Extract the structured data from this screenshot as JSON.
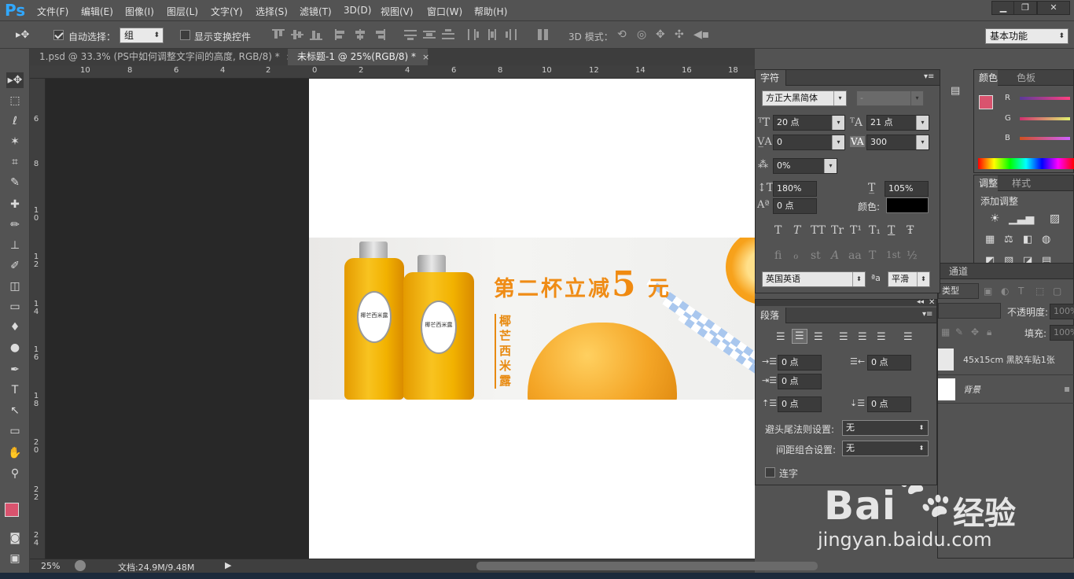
{
  "app": {
    "logo": "Ps"
  },
  "menu": [
    "文件(F)",
    "编辑(E)",
    "图像(I)",
    "图层(L)",
    "文字(Y)",
    "选择(S)",
    "滤镜(T)",
    "3D(D)",
    "视图(V)",
    "窗口(W)",
    "帮助(H)"
  ],
  "window_controls": {
    "minimize": "▁",
    "restore": "❐",
    "close": "✕"
  },
  "options": {
    "auto_select_label": "自动选择：",
    "auto_select_value": "组",
    "show_transform_label": "显示变换控件",
    "mode3d_label": "3D 模式：",
    "workspace": "基本功能"
  },
  "tabs": [
    {
      "label": "1.psd @ 33.3% (PS中如何调整文字间的高度, RGB/8) *",
      "close": "×"
    },
    {
      "label": "未标题-1 @ 25%(RGB/8) *",
      "close": "×"
    }
  ],
  "ruler_top": [
    "10",
    "8",
    "6",
    "4",
    "2",
    "0",
    "2",
    "4",
    "6",
    "8",
    "10",
    "12",
    "14",
    "16",
    "18"
  ],
  "ruler_left": [
    "6",
    "8",
    "1\n0",
    "1\n2",
    "1\n4",
    "1\n6",
    "1\n8",
    "2\n0",
    "2\n2",
    "2\n4"
  ],
  "banner": {
    "headline_pre": "第二杯立减",
    "headline_num": "5",
    "headline_post": "元",
    "vertical": "椰芒西米露",
    "bottle_label": "椰芒西米露"
  },
  "status": {
    "zoom": "25%",
    "doc": "文档:24.9M/9.48M"
  },
  "char_panel": {
    "title": "字符",
    "font": "方正大黑简体",
    "style": "-",
    "size": "20 点",
    "leading": "21 点",
    "kerning": "0",
    "tracking": "300",
    "tsume": "0%",
    "vscale": "180%",
    "hscale": "105%",
    "baseline": "0 点",
    "color_label": "颜色:",
    "language": "英国英语",
    "aa_icon": "ªa",
    "antialias": "平滑",
    "style_glyphs": [
      "T",
      "T",
      "TT",
      "Tr",
      "T¹",
      "T₁",
      "T",
      "Ŧ"
    ],
    "ot_glyphs": [
      "fi",
      "ℴ",
      "st",
      "A",
      "aa",
      "T",
      "1st",
      "½"
    ]
  },
  "para_panel": {
    "title": "段落",
    "indent_left": "0 点",
    "indent_right": "0 点",
    "indent_first": "0 点",
    "space_before": "0 点",
    "space_after": "0 点",
    "kinsoku_label": "避头尾法则设置:",
    "kinsoku_value": "无",
    "mojikumi_label": "间距组合设置:",
    "mojikumi_value": "无",
    "hyphenate_label": "连字"
  },
  "color_panel": {
    "tab1": "颜色",
    "tab2": "色板",
    "r": "R",
    "g": "G",
    "b": "B",
    "fg": "#d9536e"
  },
  "adjust_panel": {
    "tab1": "调整",
    "tab2": "样式",
    "add_label": "添加调整"
  },
  "layers_panel": {
    "channels_tab": "通道",
    "kind_label": "类型",
    "opacity_label": "不透明度:",
    "opacity_value": "100%",
    "fill_label": "填充:",
    "fill_value": "100%",
    "layers": [
      "45x15cm 黑胶车贴1张",
      "背景"
    ]
  },
  "watermark": {
    "brand": "Bai",
    "brand2": "经验",
    "url": "jingyan.baidu.com"
  }
}
